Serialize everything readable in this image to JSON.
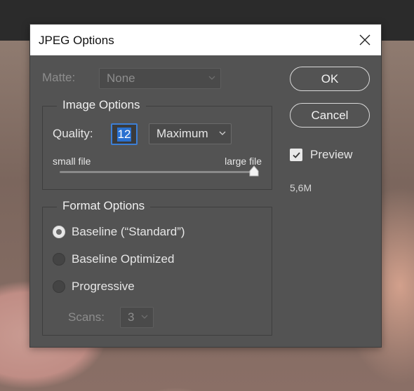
{
  "dialog": {
    "title": "JPEG Options",
    "close_icon": "close-icon"
  },
  "matte": {
    "label": "Matte:",
    "value": "None",
    "enabled": false
  },
  "image_options": {
    "title": "Image Options",
    "quality_label": "Quality:",
    "quality_value": "12",
    "quality_preset": "Maximum",
    "small_label": "small file",
    "large_label": "large file",
    "slider_level": 1.0
  },
  "format_options": {
    "title": "Format Options",
    "options": [
      {
        "label": "Baseline (“Standard”)",
        "selected": true
      },
      {
        "label": "Baseline Optimized",
        "selected": false
      },
      {
        "label": "Progressive",
        "selected": false
      }
    ],
    "scans_label": "Scans:",
    "scans_value": "3"
  },
  "buttons": {
    "ok": "OK",
    "cancel": "Cancel"
  },
  "preview": {
    "label": "Preview",
    "checked": true,
    "file_size": "5,6M"
  },
  "colors": {
    "dialog_bg": "#535353",
    "accent": "#2a71d0"
  }
}
